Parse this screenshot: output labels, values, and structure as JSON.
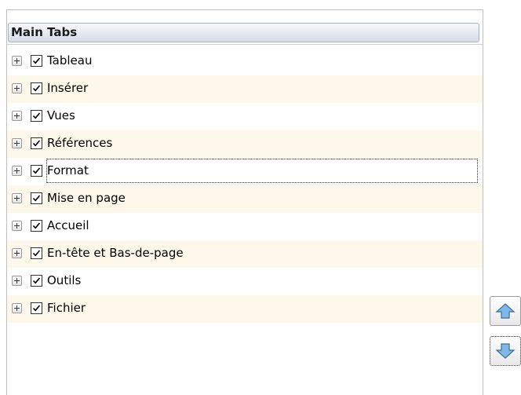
{
  "header": {
    "title": "Main Tabs"
  },
  "tabs": [
    {
      "label": "Tableau",
      "checked": true
    },
    {
      "label": "Insérer",
      "checked": true
    },
    {
      "label": "Vues",
      "checked": true
    },
    {
      "label": "Références",
      "checked": true
    },
    {
      "label": "Format",
      "checked": true,
      "focused": true
    },
    {
      "label": "Mise en page",
      "checked": true
    },
    {
      "label": "Accueil",
      "checked": true
    },
    {
      "label": "En-tête et Bas-de-page",
      "checked": true
    },
    {
      "label": "Outils",
      "checked": true
    },
    {
      "label": "Fichier",
      "checked": true
    }
  ],
  "icons": {
    "expander": "plus-box-icon",
    "check": "checkmark-icon",
    "move_up": "arrow-up-icon",
    "move_down": "arrow-down-icon"
  },
  "colors": {
    "alt_row": "#fdf8ea",
    "arrow_fill": "#7fb8e6"
  }
}
